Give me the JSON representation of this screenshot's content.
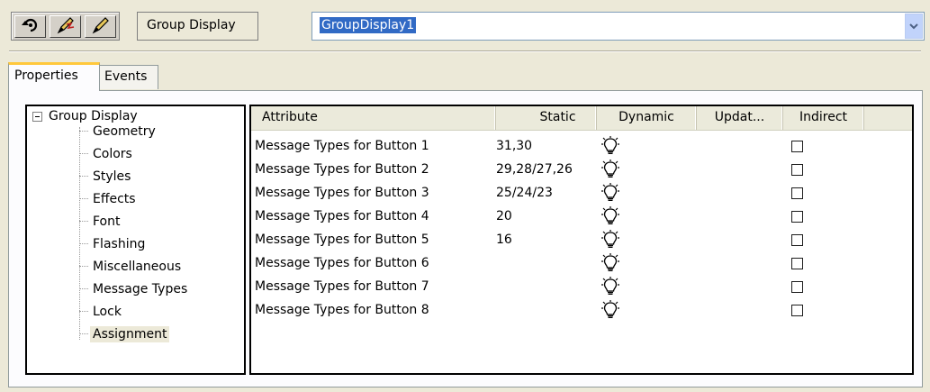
{
  "toolbar": {
    "buttons": [
      {
        "icon": "undo-arrow-icon"
      },
      {
        "icon": "pencil-lightning-icon"
      },
      {
        "icon": "pencil-icon"
      }
    ]
  },
  "object_type_label": "Group Display",
  "object_name": {
    "value": "GroupDisplay1"
  },
  "tabs": [
    {
      "label": "Properties",
      "active": true
    },
    {
      "label": "Events",
      "active": false
    }
  ],
  "tree": {
    "root": "Group Display",
    "items": [
      {
        "label": "Geometry"
      },
      {
        "label": "Colors"
      },
      {
        "label": "Styles"
      },
      {
        "label": "Effects"
      },
      {
        "label": "Font"
      },
      {
        "label": "Flashing"
      },
      {
        "label": "Miscellaneous"
      },
      {
        "label": "Message Types"
      },
      {
        "label": "Lock"
      },
      {
        "label": "Assignment",
        "selected": true
      }
    ]
  },
  "grid": {
    "columns": [
      "Attribute",
      "Static",
      "Dynamic",
      "Updat...",
      "Indirect"
    ],
    "rows": [
      {
        "attribute": "Message Types for Button 1",
        "static": "31,30",
        "dynamic_icon": "lightbulb-icon",
        "indirect": false
      },
      {
        "attribute": "Message Types for Button 2",
        "static": "29,28/27,26",
        "dynamic_icon": "lightbulb-icon",
        "indirect": false
      },
      {
        "attribute": "Message Types for Button 3",
        "static": "25/24/23",
        "dynamic_icon": "lightbulb-icon",
        "indirect": false
      },
      {
        "attribute": "Message Types for Button 4",
        "static": "20",
        "dynamic_icon": "lightbulb-icon",
        "indirect": false
      },
      {
        "attribute": "Message Types for Button 5",
        "static": "16",
        "dynamic_icon": "lightbulb-icon",
        "indirect": false
      },
      {
        "attribute": "Message Types for Button 6",
        "static": "",
        "dynamic_icon": "lightbulb-icon",
        "indirect": false
      },
      {
        "attribute": "Message Types for Button 7",
        "static": "",
        "dynamic_icon": "lightbulb-icon",
        "indirect": false
      },
      {
        "attribute": "Message Types for Button 8",
        "static": "",
        "dynamic_icon": "lightbulb-icon",
        "indirect": false
      }
    ]
  },
  "colors": {
    "window_bg": "#ece9d8",
    "selection": "#316ac5",
    "tab_highlight": "#ffc83c"
  }
}
